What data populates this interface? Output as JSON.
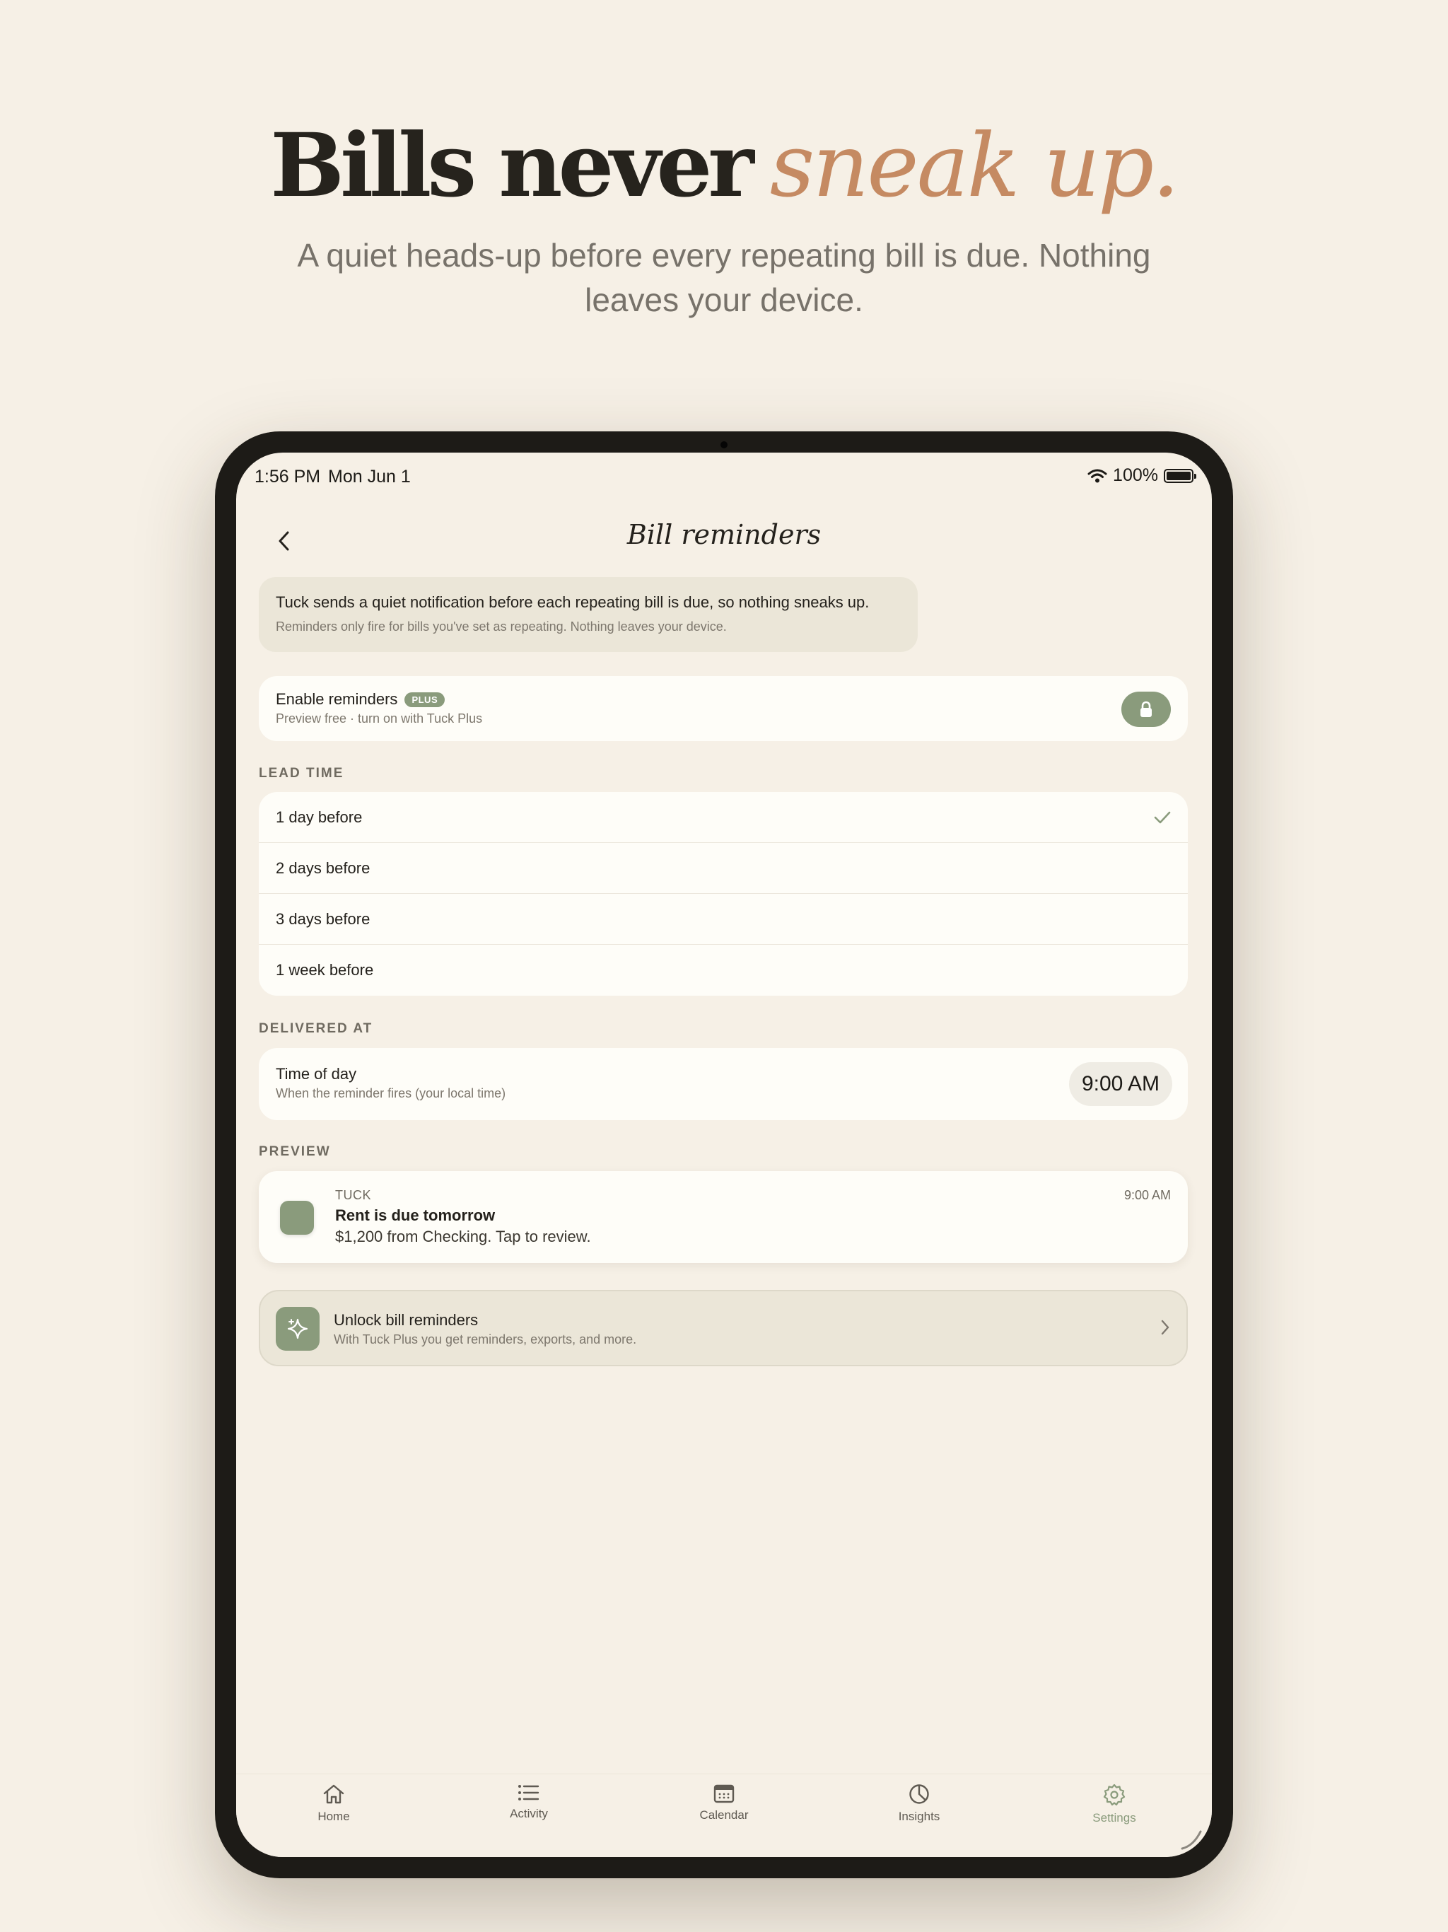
{
  "hero": {
    "title_main": "Bills never",
    "title_accent": "sneak up.",
    "subtitle": "A quiet heads-up before every repeating bill is due. Nothing leaves your device."
  },
  "status_bar": {
    "time": "1:56 PM",
    "date": "Mon Jun 1",
    "battery": "100%"
  },
  "nav": {
    "title": "Bill reminders"
  },
  "info": {
    "main": "Tuck sends a quiet notification before each repeating bill is due, so nothing sneaks up.",
    "sub": "Reminders only fire for bills you've set as repeating. Nothing leaves your device."
  },
  "enable": {
    "title": "Enable reminders",
    "badge": "PLUS",
    "subtitle": "Preview free · turn on with Tuck Plus"
  },
  "lead_time": {
    "label": "LEAD TIME",
    "options": [
      {
        "label": "1 day before",
        "selected": true
      },
      {
        "label": "2 days before",
        "selected": false
      },
      {
        "label": "3 days before",
        "selected": false
      },
      {
        "label": "1 week before",
        "selected": false
      }
    ]
  },
  "delivered": {
    "label": "DELIVERED AT",
    "title": "Time of day",
    "subtitle": "When the reminder fires (your local time)",
    "value": "9:00 AM"
  },
  "preview": {
    "label": "PREVIEW",
    "app": "TUCK",
    "time": "9:00 AM",
    "title": "Rent is due tomorrow",
    "body": "$1,200 from Checking. Tap to review."
  },
  "unlock": {
    "title": "Unlock bill reminders",
    "subtitle": "With Tuck Plus you get reminders, exports, and more."
  },
  "tabs": [
    {
      "label": "Home",
      "icon": "home-icon",
      "active": false
    },
    {
      "label": "Activity",
      "icon": "list-icon",
      "active": false
    },
    {
      "label": "Calendar",
      "icon": "calendar-icon",
      "active": false
    },
    {
      "label": "Insights",
      "icon": "pie-chart-icon",
      "active": false
    },
    {
      "label": "Settings",
      "icon": "gear-icon",
      "active": true
    }
  ],
  "colors": {
    "background": "#f6f0e6",
    "accent_green": "#8a9b7c",
    "accent_copper": "#c58a62",
    "card": "#fefdf8",
    "frame": "#1d1b17"
  }
}
